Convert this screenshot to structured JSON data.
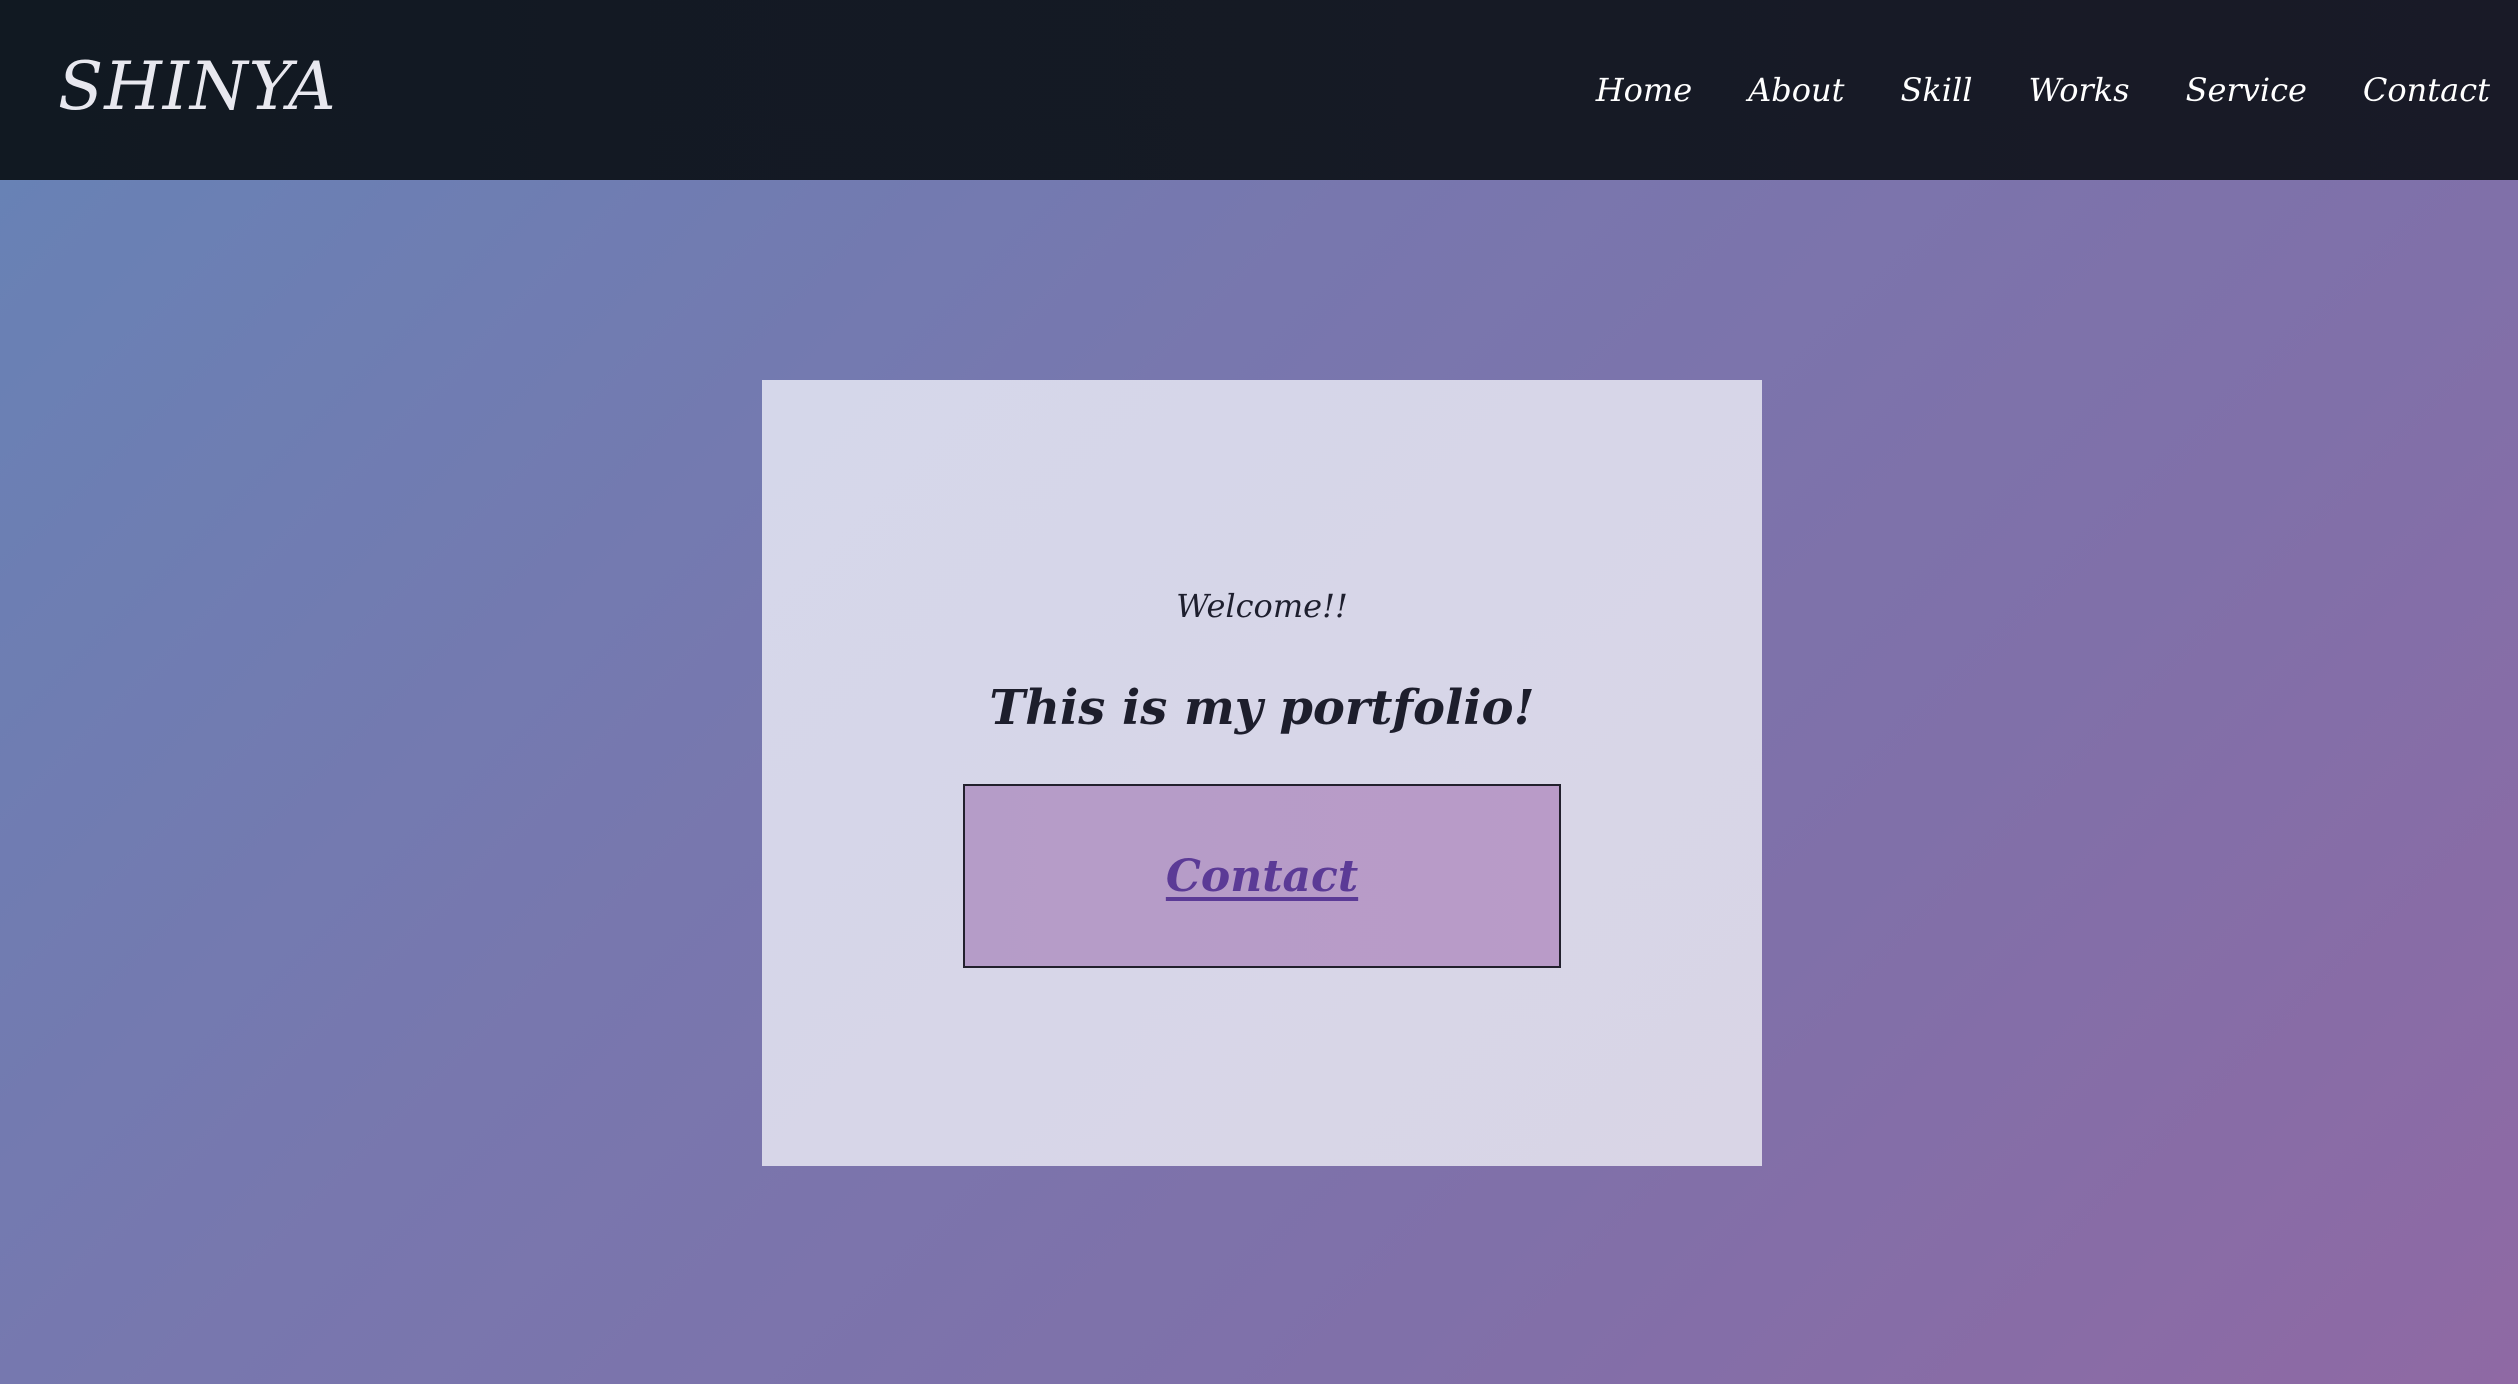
{
  "header": {
    "logo": "SHINYA",
    "nav": [
      "Home",
      "About",
      "Skill",
      "Works",
      "Service",
      "Contact"
    ]
  },
  "hero": {
    "welcome": "Welcome!!",
    "headline": "This is my portfolio!",
    "cta_label": "Contact"
  },
  "colors": {
    "header_bg": "#151a24",
    "card_bg": "#d7d6e8",
    "cta_bg": "#b79bc8",
    "cta_text": "#5b3a96",
    "gradient_start": "#6683b6",
    "gradient_end": "#8f69a4"
  }
}
